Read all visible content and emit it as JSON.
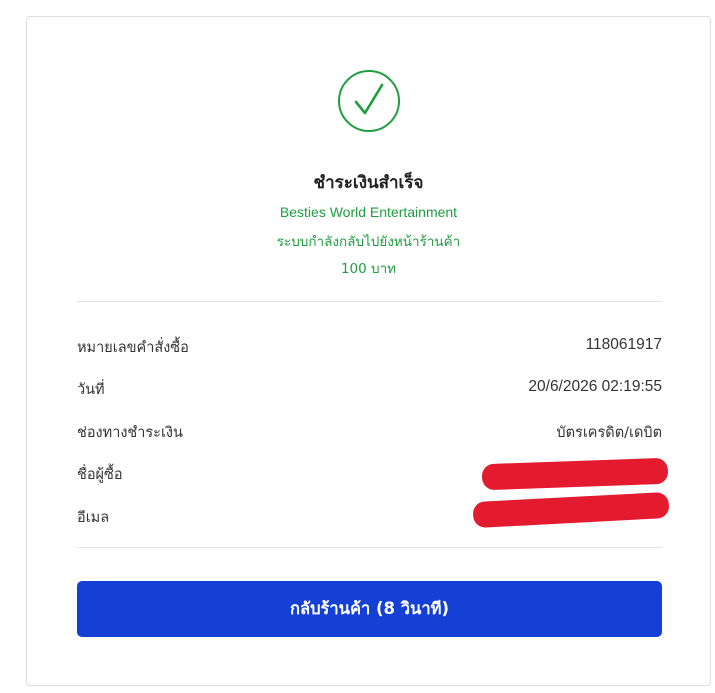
{
  "header": {
    "icon": "check-circle-icon",
    "title": "ชำระเงินสำเร็จ",
    "merchant": "Besties World Entertainment",
    "status": "ระบบกำลังกลับไปยังหน้าร้านค้า",
    "amount": "100 บาท"
  },
  "details": {
    "order_label": "หมายเลขคำสั่งซื้อ",
    "order_value": "118061917",
    "date_label": "วันที่",
    "date_value": "20/6/2026 02:19:55",
    "method_label": "ช่องทางชำระเงิน",
    "method_value": "บัตรเครดิต/เดบิต",
    "buyer_label": "ชื่อผู้ซื้อ",
    "email_label": "อีเมล"
  },
  "button": {
    "label": "กลับร้านค้า (8 วินาที)"
  },
  "colors": {
    "success": "#1e9e3e",
    "button": "#1440d6",
    "redaction": "#e41b2e"
  }
}
